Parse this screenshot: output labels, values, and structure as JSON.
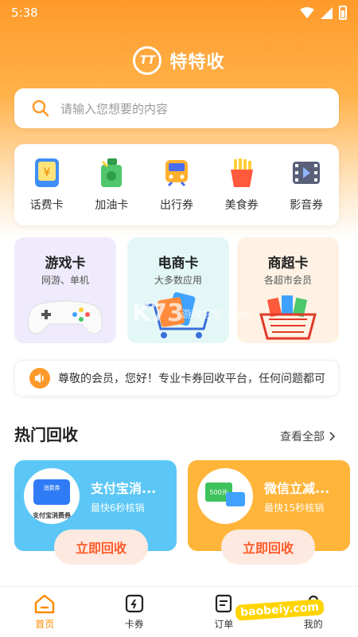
{
  "status_bar": {
    "time": "5:38"
  },
  "brand": {
    "logo_text": "TT",
    "name": "特特收"
  },
  "search": {
    "placeholder": "请输入您想要的内容"
  },
  "categories": [
    {
      "label": "话费卡",
      "icon": "phone-card-icon"
    },
    {
      "label": "加油卡",
      "icon": "fuel-card-icon"
    },
    {
      "label": "出行券",
      "icon": "travel-icon"
    },
    {
      "label": "美食券",
      "icon": "food-icon"
    },
    {
      "label": "影音券",
      "icon": "media-icon"
    }
  ],
  "promos": [
    {
      "title": "游戏卡",
      "subtitle": "网游、单机",
      "bg": "#efeafc"
    },
    {
      "title": "电商卡",
      "subtitle": "大多数应用",
      "bg": "#e3f7f6"
    },
    {
      "title": "商超卡",
      "subtitle": "各超市会员",
      "bg": "#fff2e4"
    }
  ],
  "notice": {
    "text": "尊敬的会员，您好！专业卡券回收平台，任何问题都可"
  },
  "hot": {
    "title": "热门回收",
    "view_all": "查看全部",
    "cards": [
      {
        "title": "支付宝消...",
        "subtitle": "最快6秒核销",
        "button": "立即回收",
        "thumb_text": "支付宝消费券",
        "thumb_tag": "消费券"
      },
      {
        "title": "微信立减...",
        "subtitle": "最快15秒核销",
        "button": "立即回收",
        "thumb_text": "500元"
      }
    ]
  },
  "nav": [
    {
      "label": "首页",
      "active": true
    },
    {
      "label": "卡券",
      "active": false
    },
    {
      "label": "订单",
      "active": false
    },
    {
      "label": "我的",
      "active": false
    }
  ],
  "watermarks": {
    "k73": "K73",
    "k73_sub": "游戏之家",
    "k73_url": ".com",
    "baobeiy": "baobeiy.com"
  },
  "colors": {
    "primary": "#ff9a2a",
    "accent_text": "#ff5a2a",
    "blue_card": "#5cc7f6",
    "orange_card": "#ffb53a"
  }
}
